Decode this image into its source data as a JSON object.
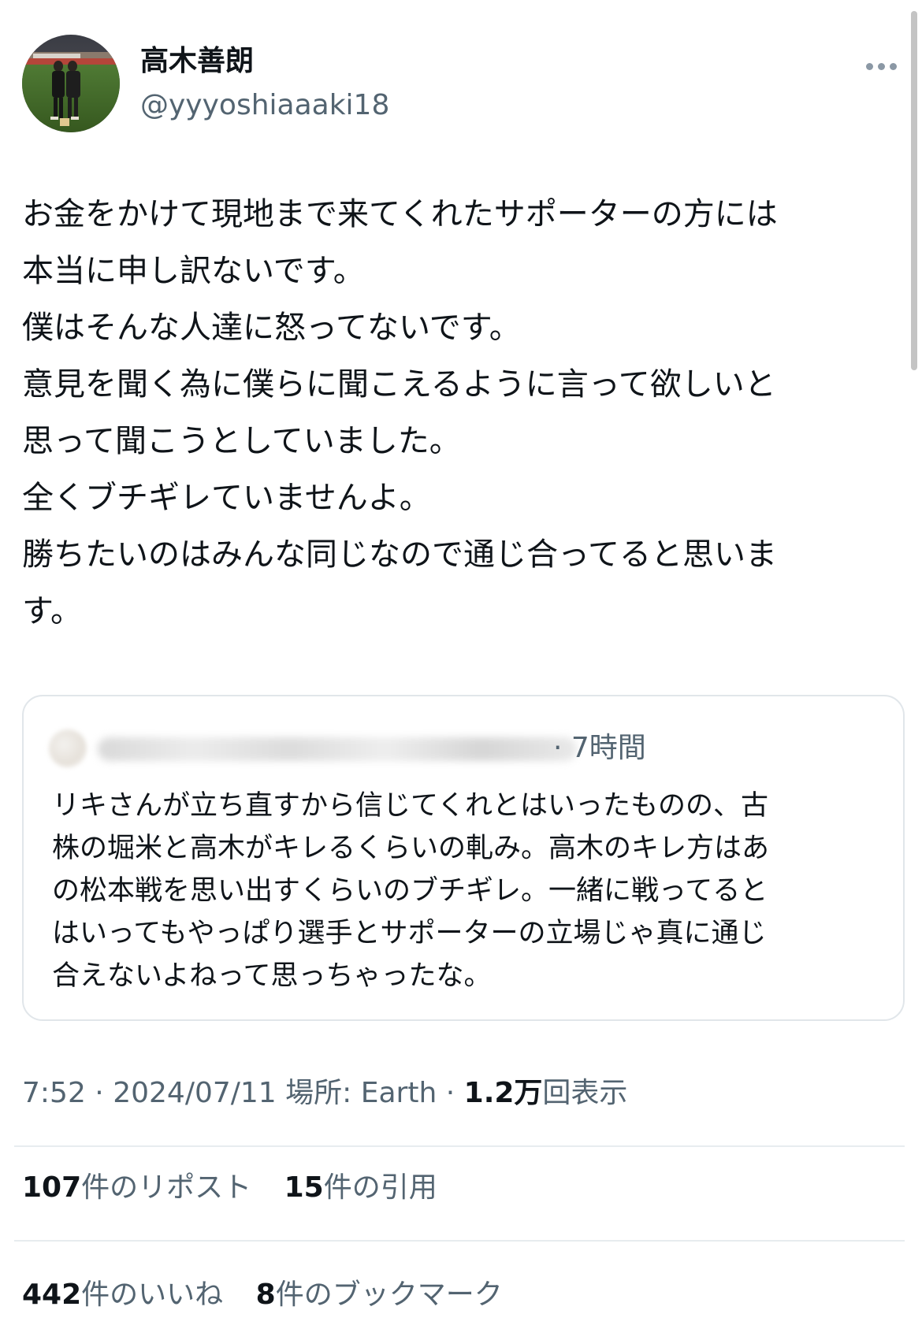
{
  "author": {
    "display_name": "高木善朗",
    "handle": "@yyyoshiaaaki18"
  },
  "tweet": {
    "lines": [
      "お金をかけて現地まで来てくれたサポーターの方には",
      "本当に申し訳ないです。",
      "僕はそんな人達に怒ってないです。",
      "意見を聞く為に僕らに聞こえるように言って欲しいと",
      "思って聞こうとしていました。",
      "全くブチギレていませんよ。",
      "勝ちたいのはみんな同じなので通じ合ってると思いま",
      "す。"
    ]
  },
  "quote": {
    "time": "· 7時間",
    "lines": [
      "リキさんが立ち直すから信じてくれとはいったものの、古",
      "株の堀米と高木がキレるくらいの軋み。高木のキレ方はあ",
      "の松本戦を思い出すくらいのブチギレ。一緒に戦ってると",
      "はいってもやっぱり選手とサポーターの立場じゃ真に通じ",
      "合えないよねって思っちゃったな。"
    ]
  },
  "meta": {
    "time": "7:52",
    "separator": "·",
    "date": "2024/07/11",
    "location": "場所: Earth",
    "views_count": "1.2万",
    "views_label": "回表示"
  },
  "stats": {
    "reposts": {
      "count": "107",
      "label": "件のリポスト"
    },
    "quotes": {
      "count": "15",
      "label": "件の引用"
    },
    "likes": {
      "count": "442",
      "label": "件のいいね"
    },
    "bookmarks": {
      "count": "8",
      "label": "件のブックマーク"
    }
  },
  "icons": {
    "more": "more-horizontal-icon"
  },
  "colors": {
    "text_primary": "#0f1419",
    "text_secondary": "#536471",
    "border": "#e1e6ea"
  }
}
